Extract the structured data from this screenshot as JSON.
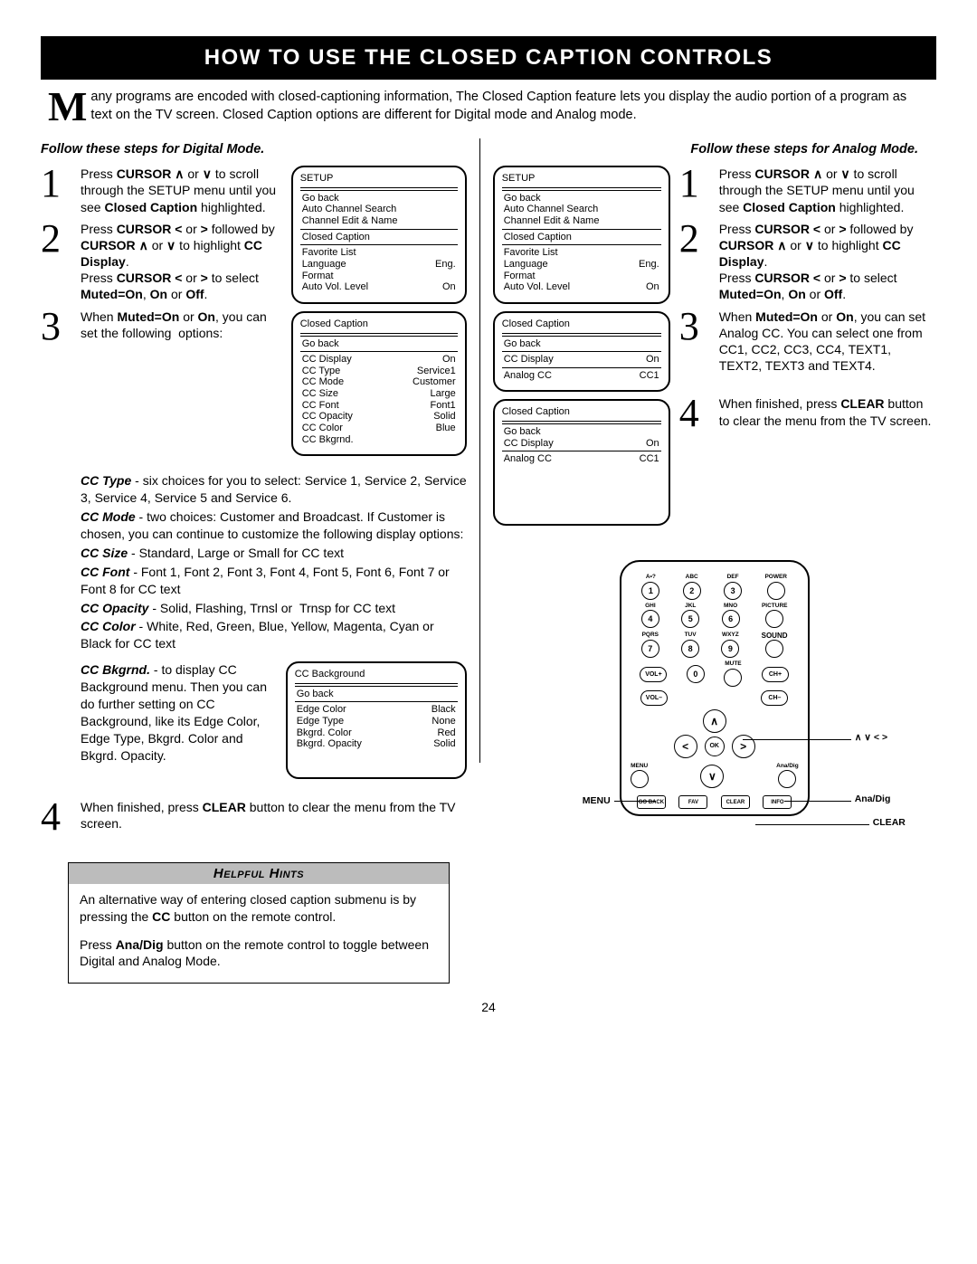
{
  "title": "HOW TO USE THE CLOSED CAPTION CONTROLS",
  "intro": "any programs are encoded with closed-captioning information,  The Closed Caption feature lets you display the audio portion of a program as text on the TV screen. Closed Caption options are different for Digital mode and Analog mode.",
  "dropcap": "M",
  "digital_head": "Follow these steps for Digital Mode.",
  "analog_head": "Follow these steps for Analog Mode.",
  "page_num": "24",
  "digital_steps": {
    "s1": "Press CURSOR ∧ or ∨ to scroll through the SETUP menu until you see Closed Caption highlighted.",
    "s2": "Press CURSOR < or > followed by CURSOR ∧ or ∨ to highlight CC Display.\nPress CURSOR < or > to select Muted=On, On or Off.",
    "s3": "When Muted=On or On, you can set the following  options:",
    "s4": "When finished, press CLEAR button to clear the menu from the TV screen."
  },
  "analog_steps": {
    "s1": "Press CURSOR ∧ or ∨ to scroll through the SETUP menu until you see Closed Caption highlighted.",
    "s2": "Press CURSOR < or > followed by CURSOR ∧ or ∨ to highlight CC Display.\nPress CURSOR < or > to select Muted=On, On or Off.",
    "s3": "When Muted=On or On, you can set Analog CC. You can select one from CC1, CC2, CC3, CC4, TEXT1, TEXT2, TEXT3 and TEXT4.",
    "s4": "When finished, press CLEAR button to clear the menu from the TV screen."
  },
  "options": {
    "cc_type": "CC Type - six choices for you to select: Service 1, Service 2, Service 3, Service 4, Service 5 and Service 6.",
    "cc_mode": "CC Mode - two choices: Customer and Broadcast. If Customer is chosen, you can continue to customize the following display options:",
    "cc_size": "CC Size - Standard, Large or Small for CC text",
    "cc_font": "CC Font - Font 1, Font 2, Font 3, Font 4, Font 5, Font 6, Font 7 or Font 8 for CC text",
    "cc_opacity": "CC Opacity - Solid, Flashing, Trnsl or  Trnsp for CC text",
    "cc_color": "CC Color - White, Red, Green, Blue, Yellow, Magenta, Cyan or Black for CC text",
    "cc_bkg": "CC Bkgrnd. - to display CC Background menu. Then you can do further setting on CC Background, like its Edge Color, Edge Type, Bkgrd. Color and Bkgrd. Opacity."
  },
  "osd_setup": {
    "title": "SETUP",
    "rows": [
      [
        "Go back",
        ""
      ],
      [
        "Auto Channel Search",
        ""
      ],
      [
        "Channel Edit & Name",
        ""
      ],
      [
        "Closed Caption",
        ""
      ],
      [
        "Favorite List",
        ""
      ],
      [
        "Language",
        "Eng."
      ],
      [
        "Format",
        ""
      ],
      [
        "Auto Vol. Level",
        "On"
      ]
    ]
  },
  "osd_cc_digital": {
    "title": "Closed Caption",
    "rows": [
      [
        "Go back",
        ""
      ],
      [
        "CC Display",
        "On"
      ],
      [
        "CC Type",
        "Service1"
      ],
      [
        "CC Mode",
        "Customer"
      ],
      [
        "CC Size",
        "Large"
      ],
      [
        "CC Font",
        "Font1"
      ],
      [
        "CC Opacity",
        "Solid"
      ],
      [
        "CC Color",
        "Blue"
      ],
      [
        "CC Bkgrnd.",
        ""
      ]
    ]
  },
  "osd_cc_analog1": {
    "title": "Closed Caption",
    "rows": [
      [
        "Go back",
        ""
      ],
      [
        "CC Display",
        "On"
      ],
      [
        "Analog CC",
        "CC1"
      ]
    ]
  },
  "osd_cc_analog2": {
    "title": "Closed Caption",
    "rows": [
      [
        "Go back",
        ""
      ],
      [
        "CC Display",
        "On"
      ],
      [
        "Analog CC",
        "CC1"
      ]
    ]
  },
  "osd_ccbg": {
    "title": "CC Background",
    "rows": [
      [
        "Go back",
        ""
      ],
      [
        "Edge Color",
        "Black"
      ],
      [
        "Edge Type",
        "None"
      ],
      [
        "Bkgrd. Color",
        "Red"
      ],
      [
        "Bkgrd. Opacity",
        "Solid"
      ]
    ]
  },
  "hints": {
    "head": "Helpful Hints",
    "p1": "An alternative way of entering closed caption submenu is by pressing the CC button on the remote control.",
    "p2": "Press Ana/Dig button on the remote control to toggle between Digital and Analog Mode."
  },
  "remote": {
    "row1_labels": [
      "A•?",
      "ABC",
      "DEF",
      "POWER"
    ],
    "row1_nums": [
      "1",
      "2",
      "3"
    ],
    "row2_labels": [
      "GHI",
      "JKL",
      "MNO",
      "PICTURE"
    ],
    "row2_nums": [
      "4",
      "5",
      "6"
    ],
    "row3_labels": [
      "PQRS",
      "TUV",
      "WXYZ",
      "SOUND"
    ],
    "row3_nums": [
      "7",
      "8",
      "9"
    ],
    "row4": [
      "VOL+",
      "0",
      "MUTE",
      "CH+"
    ],
    "row5": [
      "VOL–",
      "",
      "",
      "CH–"
    ],
    "nav_up": "∧",
    "nav_down": "∨",
    "nav_left": "<",
    "nav_right": ">",
    "nav_ok": "OK",
    "menu": "MENU",
    "anadig": "Ana/Dig",
    "bottom": [
      "GO BACK",
      "FAV",
      "CLEAR",
      "INFO"
    ],
    "side_menu": "MENU",
    "side_nav": "∧  ∨  <  >",
    "side_anadig": "Ana/Dig",
    "side_clear": "CLEAR"
  }
}
